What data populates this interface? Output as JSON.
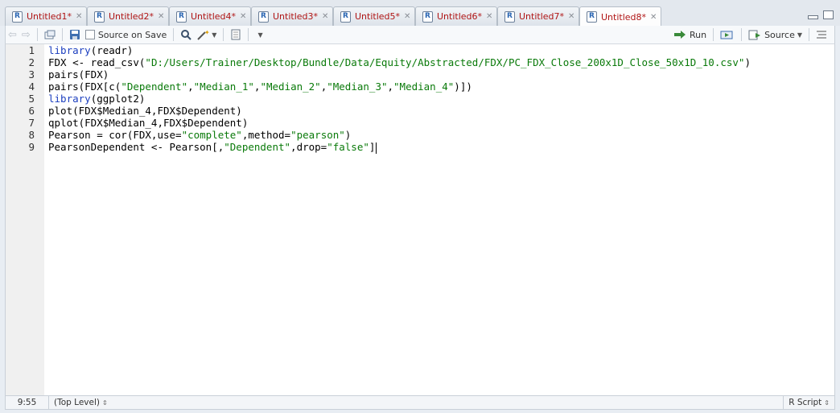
{
  "tabs": [
    {
      "label": "Untitled1*"
    },
    {
      "label": "Untitled2*"
    },
    {
      "label": "Untitled4*"
    },
    {
      "label": "Untitled3*"
    },
    {
      "label": "Untitled5*"
    },
    {
      "label": "Untitled6*"
    },
    {
      "label": "Untitled7*"
    },
    {
      "label": "Untitled8*",
      "active": true
    }
  ],
  "toolbar": {
    "source_on_save": "Source on Save",
    "run": "Run",
    "source": "Source"
  },
  "editor": {
    "lines": [
      {
        "num": "1",
        "code": "library(readr)"
      },
      {
        "num": "2",
        "code": "FDX <- read_csv(\"D:/Users/Trainer/Desktop/Bundle/Data/Equity/Abstracted/FDX/PC_FDX_Close_200x1D_Close_50x1D_10.csv\")"
      },
      {
        "num": "3",
        "code": "pairs(FDX)"
      },
      {
        "num": "4",
        "code": "pairs(FDX[c(\"Dependent\",\"Median_1\",\"Median_2\",\"Median_3\",\"Median_4\")])"
      },
      {
        "num": "5",
        "code": "library(ggplot2)"
      },
      {
        "num": "6",
        "code": "plot(FDX$Median_4,FDX$Dependent)"
      },
      {
        "num": "7",
        "code": "qplot(FDX$Median_4,FDX$Dependent)"
      },
      {
        "num": "8",
        "code": "Pearson = cor(FDX,use=\"complete\",method=\"pearson\")"
      },
      {
        "num": "9",
        "code": "PearsonDependent <- Pearson[,\"Dependent\",drop=\"false\"]"
      }
    ]
  },
  "status": {
    "position": "9:55",
    "scope": "(Top Level)",
    "file_type": "R Script"
  },
  "colors": {
    "tab_label": "#b01515",
    "keyword": "#1c3fbf",
    "string": "#0a7a0a"
  }
}
